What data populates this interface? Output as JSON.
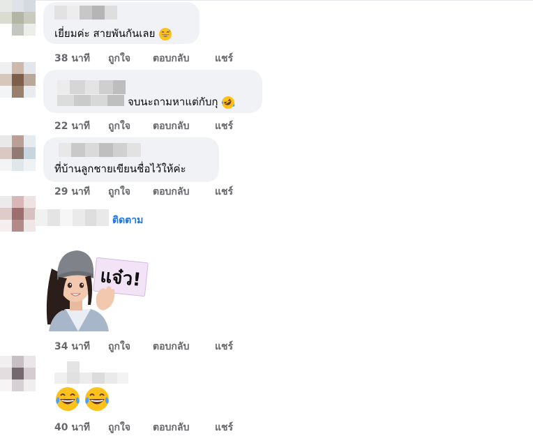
{
  "comments": [
    {
      "text": "เยี่ยมค่ะ สายพันกันเลย",
      "emoji": "grinning-sweat",
      "time": "38 นาที",
      "like": "ถูกใจ",
      "reply": "ตอบกลับ",
      "share": "แชร์"
    },
    {
      "text": "จบนะถามหาแต่กับกุ",
      "emoji": "rofl",
      "time": "22 นาที",
      "like": "ถูกใจ",
      "reply": "ตอบกลับ",
      "share": "แชร์"
    },
    {
      "text": "ที่บ้านลูกชายเขียนชื่อไว้ให้ค่ะ",
      "time": "29 นาที",
      "like": "ถูกใจ",
      "reply": "ตอบกลับ",
      "share": "แชร์"
    },
    {
      "follow": "ติดตาม",
      "sticker_text": "แจ๋ว!",
      "time": "34 นาที",
      "like": "ถูกใจ",
      "reply": "ตอบกลับ",
      "share": "แชร์"
    },
    {
      "emoji": "joy-joy",
      "time": "40 นาที",
      "like": "ถูกใจ",
      "reply": "ตอบกลับ",
      "share": "แชร์"
    }
  ],
  "colors": {
    "bubble": "#f0f2f5",
    "action_text": "#65676b",
    "link": "#1b74e4"
  }
}
